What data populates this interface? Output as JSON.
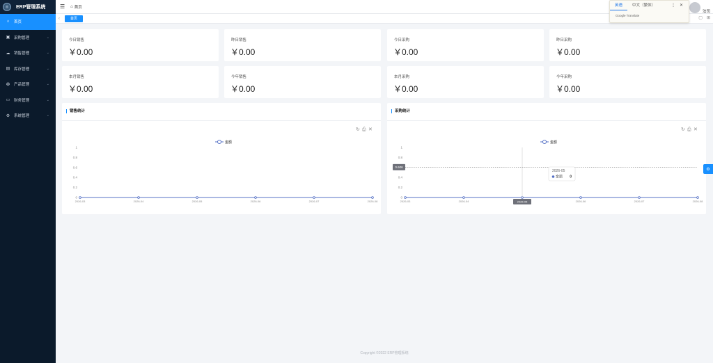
{
  "app": {
    "title": "ERP管理系统",
    "footer": "Copyright ©2022 ERP管理系统"
  },
  "sidebar": {
    "items": [
      {
        "label": "首页",
        "icon": "home-icon",
        "glyph": "⌂"
      },
      {
        "label": "采购管理",
        "icon": "purchase-icon",
        "glyph": "▣"
      },
      {
        "label": "销售管理",
        "icon": "sales-icon",
        "glyph": "☁"
      },
      {
        "label": "库存管理",
        "icon": "inventory-icon",
        "glyph": "▤"
      },
      {
        "label": "产品管理",
        "icon": "product-icon",
        "glyph": "❂"
      },
      {
        "label": "财务管理",
        "icon": "finance-icon",
        "glyph": "▭"
      },
      {
        "label": "系统管理",
        "icon": "settings-icon",
        "glyph": "⚙"
      }
    ]
  },
  "header": {
    "breadcrumb": "首页",
    "user": "法司"
  },
  "tabs": {
    "active": "首页"
  },
  "translate": {
    "tab1": "英语",
    "tab2": "中文（繁体）",
    "brand": "Google Translate"
  },
  "stats": [
    {
      "label": "今日销售",
      "value": "￥0.00"
    },
    {
      "label": "昨日销售",
      "value": "￥0.00"
    },
    {
      "label": "今日采购",
      "value": "￥0.00"
    },
    {
      "label": "昨日采购",
      "value": "￥0.00"
    },
    {
      "label": "本月销售",
      "value": "￥0.00"
    },
    {
      "label": "今年销售",
      "value": "￥0.00"
    },
    {
      "label": "本月采购",
      "value": "￥0.00"
    },
    {
      "label": "今年采购",
      "value": "￥0.00"
    }
  ],
  "chart_data": [
    {
      "type": "line",
      "title": "销售统计",
      "categories": [
        "2026-03",
        "2026-04",
        "2026-05",
        "2026-06",
        "2026-07",
        "2026-08"
      ],
      "series": [
        {
          "name": "金额",
          "values": [
            0,
            0,
            0,
            0,
            0,
            0
          ]
        }
      ],
      "ylim": [
        0,
        1
      ],
      "yticks": [
        "0",
        "0.2",
        "0.4",
        "0.6",
        "0.8",
        "1"
      ],
      "toolbox": [
        "↻",
        "⎙",
        "✕"
      ]
    },
    {
      "type": "line",
      "title": "采购统计",
      "categories": [
        "2026-03",
        "2026-04",
        "2026-05",
        "2026-06",
        "2026-07",
        "2026-08"
      ],
      "series": [
        {
          "name": "金额",
          "values": [
            0,
            0,
            0,
            0,
            0,
            0
          ]
        }
      ],
      "ylim": [
        0,
        1
      ],
      "yticks": [
        "0",
        "0.2",
        "0.4",
        "0.6",
        "0.8",
        "1"
      ],
      "toolbox": [
        "↻",
        "⎙",
        "✕"
      ],
      "tooltip": {
        "title": "2026-05",
        "series": "金额",
        "value": "0"
      },
      "crosshair": {
        "category": "2026-05",
        "y": 0.606,
        "ylabel": "0.606"
      }
    }
  ]
}
